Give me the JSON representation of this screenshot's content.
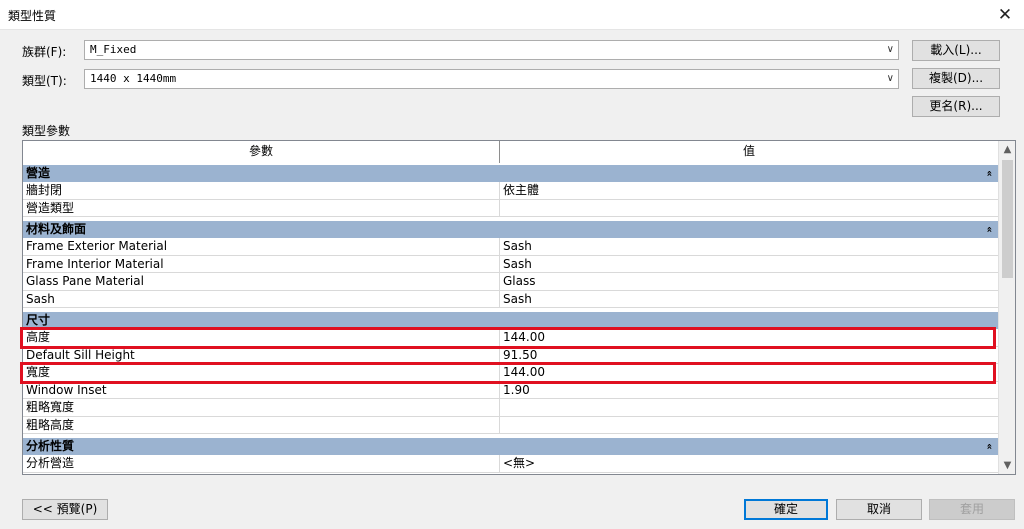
{
  "window": {
    "title": "類型性質",
    "close_glyph": "✕"
  },
  "family": {
    "label": "族群(F):",
    "value": "M_Fixed"
  },
  "type": {
    "label": "類型(T):",
    "value": "1440 x 1440mm"
  },
  "buttons": {
    "load": "載入(L)...",
    "duplicate": "複製(D)...",
    "rename": "更名(R)...",
    "preview": "<< 預覽(P)",
    "ok": "確定",
    "cancel": "取消",
    "apply": "套用"
  },
  "section_label": "類型參數",
  "table": {
    "col_param": "參數",
    "col_value": "值",
    "groups": [
      {
        "name": "營造",
        "rows": [
          {
            "param": "牆封閉",
            "value": "依主體"
          },
          {
            "param": "營造類型",
            "value": ""
          }
        ]
      },
      {
        "name": "材料及飾面",
        "rows": [
          {
            "param": "Frame Exterior Material",
            "value": "Sash"
          },
          {
            "param": "Frame Interior Material",
            "value": "Sash"
          },
          {
            "param": "Glass Pane Material",
            "value": "Glass"
          },
          {
            "param": "Sash",
            "value": "Sash"
          }
        ]
      },
      {
        "name": "尺寸",
        "rows": [
          {
            "param": "高度",
            "value": "144.00"
          },
          {
            "param": "Default Sill Height",
            "value": "91.50"
          },
          {
            "param": "寬度",
            "value": "144.00"
          },
          {
            "param": "Window Inset",
            "value": "1.90"
          },
          {
            "param": "粗略寬度",
            "value": ""
          },
          {
            "param": "粗略高度",
            "value": ""
          }
        ]
      },
      {
        "name": "分析性質",
        "rows": [
          {
            "param": "分析營造",
            "value": "<無>"
          }
        ]
      }
    ]
  },
  "icons": {
    "collapse": "«",
    "dropdown": "∨",
    "scroll_up": "▲",
    "scroll_down": "▼"
  },
  "colors": {
    "group_header": "#9bb3d0",
    "highlight": "#e01020",
    "default_button_border": "#0078d7"
  }
}
